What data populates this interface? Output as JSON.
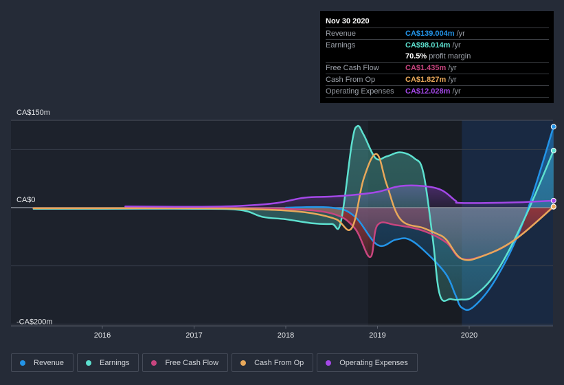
{
  "tooltip": {
    "date": "Nov 30 2020",
    "rows": [
      {
        "label": "Revenue",
        "value": "CA$139.004m",
        "unit": "/yr",
        "color": "#2394e8"
      },
      {
        "label": "Earnings",
        "value": "CA$98.014m",
        "unit": "/yr",
        "color": "#5de0cf"
      },
      {
        "label": "",
        "value": "70.5%",
        "unit": "profit margin",
        "color": "#ffffff"
      },
      {
        "label": "Free Cash Flow",
        "value": "CA$1.435m",
        "unit": "/yr",
        "color": "#c8457f"
      },
      {
        "label": "Cash From Op",
        "value": "CA$1.827m",
        "unit": "/yr",
        "color": "#e8a85a"
      },
      {
        "label": "Operating Expenses",
        "value": "CA$12.028m",
        "unit": "/yr",
        "color": "#a448e8"
      }
    ]
  },
  "legend": [
    {
      "label": "Revenue",
      "color": "#2394e8"
    },
    {
      "label": "Earnings",
      "color": "#5de0cf"
    },
    {
      "label": "Free Cash Flow",
      "color": "#c8457f"
    },
    {
      "label": "Cash From Op",
      "color": "#e8a85a"
    },
    {
      "label": "Operating Expenses",
      "color": "#a448e8"
    }
  ],
  "chart_data": {
    "type": "area",
    "title": "",
    "xlabel": "",
    "ylabel": "",
    "y_unit": "CA$m",
    "ylim": [
      -200,
      150
    ],
    "xlim": [
      2015.25,
      2020.92
    ],
    "y_tick_labels": [
      {
        "value": 150,
        "label": "CA$150m"
      },
      {
        "value": 0,
        "label": "CA$0"
      },
      {
        "value": -200,
        "label": "-CA$200m"
      }
    ],
    "gridlines": [
      150,
      100,
      0,
      -100,
      -200
    ],
    "x_ticks": [
      2016,
      2017,
      2018,
      2019,
      2020
    ],
    "x_tick_labels": [
      "2016",
      "2017",
      "2018",
      "2019",
      "2020"
    ],
    "highlight_start": 2019.92,
    "past_shade_start": 2019.0,
    "series": [
      {
        "name": "Revenue",
        "color": "#2394e8",
        "points": [
          [
            2018.0,
            0
          ],
          [
            2018.5,
            0
          ],
          [
            2018.75,
            -15
          ],
          [
            2019.0,
            -64
          ],
          [
            2019.2,
            -55
          ],
          [
            2019.35,
            -55
          ],
          [
            2019.55,
            -80
          ],
          [
            2019.75,
            -115
          ],
          [
            2019.85,
            -150
          ],
          [
            2019.92,
            -172
          ],
          [
            2020.05,
            -170
          ],
          [
            2020.3,
            -120
          ],
          [
            2020.6,
            -20
          ],
          [
            2020.92,
            139
          ]
        ]
      },
      {
        "name": "Earnings",
        "color": "#5de0cf",
        "points": [
          [
            2015.25,
            -2
          ],
          [
            2016.0,
            -2
          ],
          [
            2017.0,
            -2
          ],
          [
            2017.5,
            -4
          ],
          [
            2017.75,
            -16
          ],
          [
            2018.0,
            -20
          ],
          [
            2018.3,
            -27
          ],
          [
            2018.5,
            -28
          ],
          [
            2018.6,
            -25
          ],
          [
            2018.72,
            110
          ],
          [
            2018.78,
            140
          ],
          [
            2018.85,
            125
          ],
          [
            2018.98,
            85
          ],
          [
            2019.1,
            88
          ],
          [
            2019.25,
            95
          ],
          [
            2019.4,
            85
          ],
          [
            2019.5,
            60
          ],
          [
            2019.6,
            -50
          ],
          [
            2019.68,
            -150
          ],
          [
            2019.8,
            -157
          ],
          [
            2019.9,
            -158
          ],
          [
            2020.05,
            -152
          ],
          [
            2020.3,
            -110
          ],
          [
            2020.6,
            -20
          ],
          [
            2020.92,
            98
          ]
        ]
      },
      {
        "name": "Free Cash Flow",
        "color": "#c8457f",
        "points": [
          [
            2015.25,
            -1
          ],
          [
            2017.0,
            -1
          ],
          [
            2017.5,
            -1
          ],
          [
            2018.0,
            -2
          ],
          [
            2018.5,
            -10
          ],
          [
            2018.75,
            -35
          ],
          [
            2018.92,
            -85
          ],
          [
            2019.0,
            -30
          ],
          [
            2019.2,
            -30
          ],
          [
            2019.5,
            -40
          ],
          [
            2019.75,
            -60
          ],
          [
            2019.92,
            -88
          ],
          [
            2020.2,
            -80
          ],
          [
            2020.5,
            -55
          ],
          [
            2020.92,
            1.4
          ]
        ]
      },
      {
        "name": "Cash From Op",
        "color": "#e8a85a",
        "points": [
          [
            2015.25,
            -1
          ],
          [
            2016.0,
            -1
          ],
          [
            2017.0,
            -1
          ],
          [
            2017.5,
            -2
          ],
          [
            2018.0,
            -5
          ],
          [
            2018.3,
            -10
          ],
          [
            2018.55,
            -20
          ],
          [
            2018.72,
            -35
          ],
          [
            2018.85,
            50
          ],
          [
            2018.99,
            92
          ],
          [
            2019.1,
            40
          ],
          [
            2019.25,
            -20
          ],
          [
            2019.5,
            -35
          ],
          [
            2019.65,
            -45
          ],
          [
            2019.75,
            -55
          ],
          [
            2019.92,
            -88
          ],
          [
            2020.15,
            -83
          ],
          [
            2020.5,
            -55
          ],
          [
            2020.92,
            1.8
          ]
        ]
      },
      {
        "name": "Operating Expenses",
        "color": "#a448e8",
        "points": [
          [
            2016.25,
            2
          ],
          [
            2017.0,
            1.5
          ],
          [
            2017.5,
            3
          ],
          [
            2017.9,
            8
          ],
          [
            2018.2,
            17
          ],
          [
            2018.5,
            19
          ],
          [
            2018.75,
            22
          ],
          [
            2019.0,
            27
          ],
          [
            2019.25,
            37
          ],
          [
            2019.5,
            37
          ],
          [
            2019.7,
            30
          ],
          [
            2019.85,
            12
          ],
          [
            2019.92,
            8
          ],
          [
            2020.5,
            9
          ],
          [
            2020.92,
            12
          ]
        ]
      }
    ]
  }
}
